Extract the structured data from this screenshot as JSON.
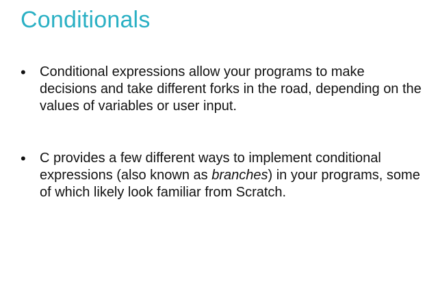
{
  "slide": {
    "title": "Conditionals",
    "title_color": "#2ab0c4",
    "bullet_glyph": "•",
    "bullets": [
      {
        "text": "Conditional expressions allow your programs to make decisions and take different forks in the road, depending on the values of variables or user input."
      },
      {
        "before": "C provides a few different ways to implement conditional expressions (also known as ",
        "emphasis": "branches",
        "after": ") in your programs, some of which likely look familiar from Scratch."
      }
    ]
  }
}
